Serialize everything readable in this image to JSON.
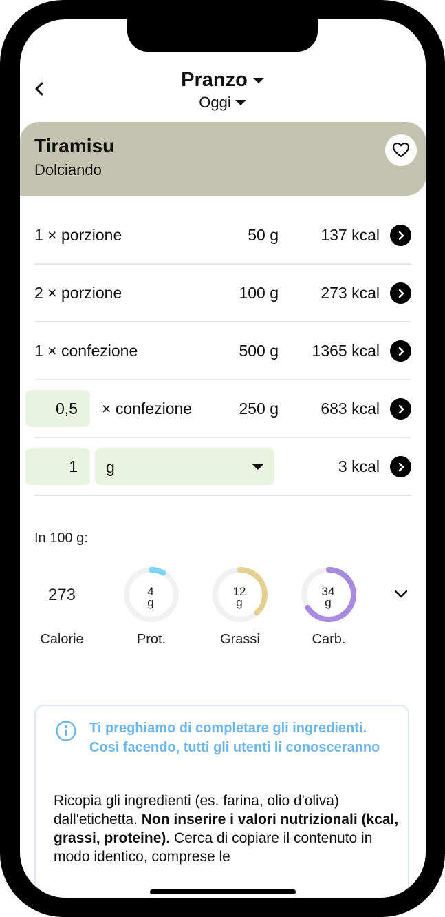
{
  "header": {
    "title": "Pranzo",
    "subtitle": "Oggi"
  },
  "food": {
    "name": "Tiramisu",
    "brand": "Dolciando"
  },
  "portions": [
    {
      "label": "1 × porzione",
      "grams": "50 g",
      "kcal": "137 kcal"
    },
    {
      "label": "2 × porzione",
      "grams": "100 g",
      "kcal": "273 kcal"
    },
    {
      "label": "1 × confezione",
      "grams": "500 g",
      "kcal": "1365 kcal"
    }
  ],
  "custom_package": {
    "quantity": "0,5",
    "label": "× confezione",
    "grams": "250 g",
    "kcal": "683 kcal"
  },
  "custom_unit": {
    "quantity": "1",
    "unit": "g",
    "kcal": "3 kcal"
  },
  "nutrition": {
    "heading": "In 100 g:",
    "calories": {
      "value": "273",
      "label": "Calorie"
    },
    "protein": {
      "value": "4",
      "unit": "g",
      "label": "Prot.",
      "fraction": 0.08,
      "color": "#7fd3f5"
    },
    "fat": {
      "value": "12",
      "unit": "g",
      "label": "Grassi",
      "fraction": 0.38,
      "color": "#e6d08f"
    },
    "carbs": {
      "value": "34",
      "unit": "g",
      "label": "Carb.",
      "fraction": 0.66,
      "color": "#a78be0"
    }
  },
  "info": {
    "title": "Ti preghiamo di completare gli ingredienti. Così facendo, tutti gli utenti li conosceranno",
    "body_1": "Ricopia gli ingredienti (es. farina, olio d'oliva) dall'etichetta. ",
    "body_bold": "Non inserire i valori nutrizionali (kcal, grassi, proteine).",
    "body_2": " Cerca di copiare il contenuto in modo identico, comprese le"
  }
}
